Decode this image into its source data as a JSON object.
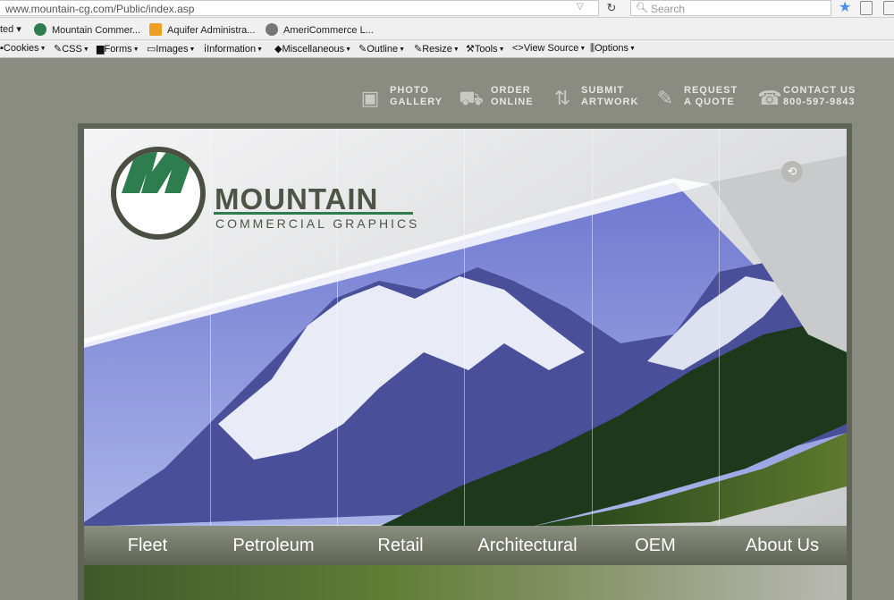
{
  "browser": {
    "url": "www.mountain-cg.com/Public/index.asp",
    "search_placeholder": "Search"
  },
  "bookmarks": [
    {
      "label": "ted",
      "has_caret": true
    },
    {
      "label": "Mountain Commer...",
      "icon_color": "#2e7d4f"
    },
    {
      "label": "Aquifer Administra...",
      "icon_color": "#f0a020"
    },
    {
      "label": "AmeriCommerce L...",
      "icon_color": "#777777"
    }
  ],
  "devtools": [
    "Cookies",
    "CSS",
    "Forms",
    "Images",
    "Information",
    "Miscellaneous",
    "Outline",
    "Resize",
    "Tools",
    "View Source",
    "Options"
  ],
  "topnav": [
    {
      "line1": "PHOTO",
      "line2": "GALLERY",
      "icon": "photo-icon"
    },
    {
      "line1": "ORDER",
      "line2": "ONLINE",
      "icon": "cart-icon"
    },
    {
      "line1": "SUBMIT",
      "line2": "ARTWORK",
      "icon": "upload-icon"
    },
    {
      "line1": "REQUEST",
      "line2": "A QUOTE",
      "icon": "form-icon"
    },
    {
      "line1": "CONTACT US",
      "line2": "800-597-9843",
      "icon": "phone-icon"
    }
  ],
  "logo": {
    "word": "MOUNTAIN",
    "sub": "COMMERCIAL GRAPHICS"
  },
  "categories": [
    "Fleet",
    "Petroleum",
    "Retail",
    "Architectural",
    "OEM",
    "About Us"
  ],
  "colors": {
    "page_bg": "#8a8c82",
    "frame": "#5f6456",
    "brand_green": "#2e7d4f",
    "brand_gray": "#4f5447"
  }
}
